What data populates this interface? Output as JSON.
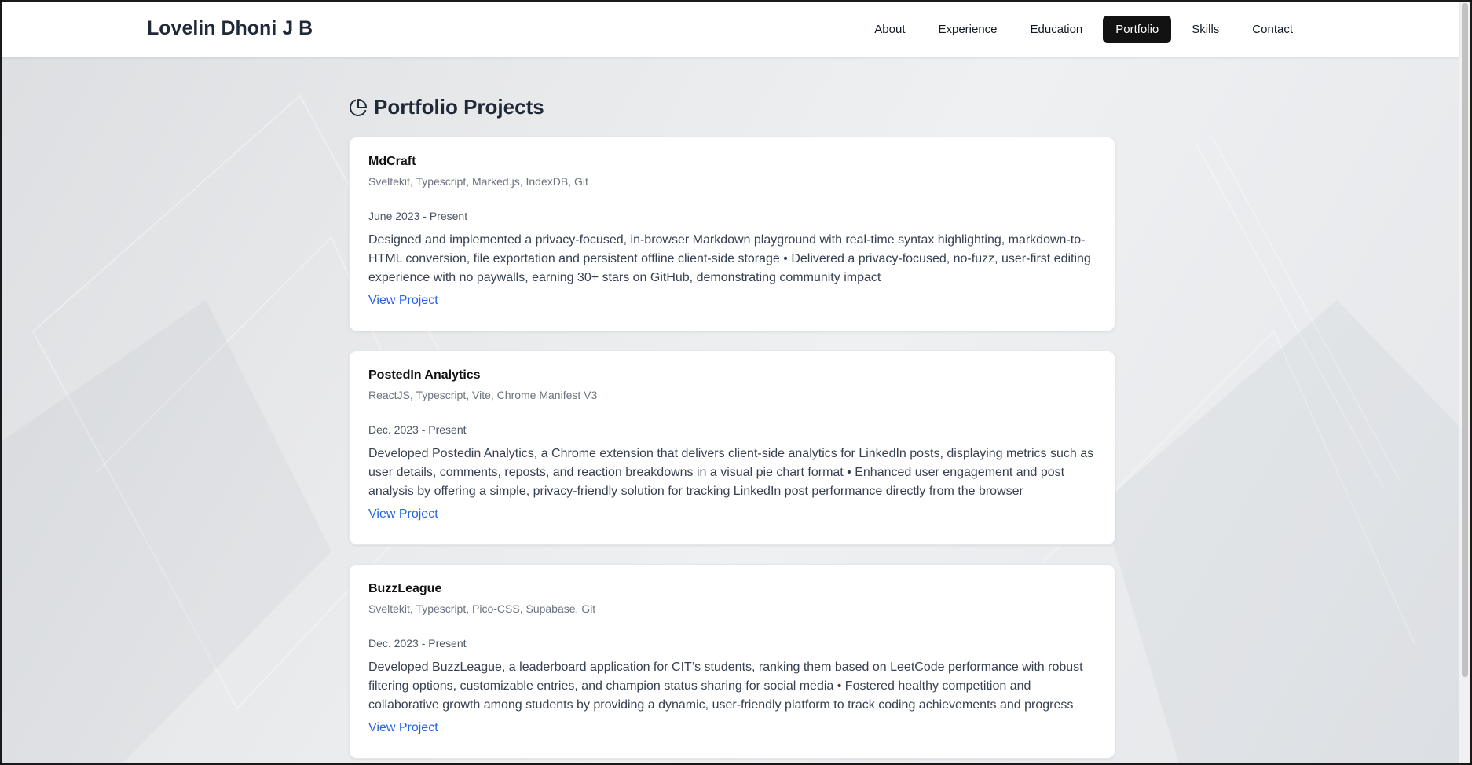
{
  "brand": "Lovelin Dhoni J B",
  "nav": [
    {
      "label": "About",
      "active": false
    },
    {
      "label": "Experience",
      "active": false
    },
    {
      "label": "Education",
      "active": false
    },
    {
      "label": "Portfolio",
      "active": true
    },
    {
      "label": "Skills",
      "active": false
    },
    {
      "label": "Contact",
      "active": false
    }
  ],
  "section": {
    "title": "Portfolio Projects",
    "icon": "pie-chart-icon"
  },
  "projects": [
    {
      "title": "MdCraft",
      "tech": "Sveltekit, Typescript, Marked.js, IndexDB, Git",
      "date": "June 2023 - Present",
      "description": "Designed and implemented a privacy-focused, in-browser Markdown playground with real-time syntax highlighting, markdown-to-HTML conversion, file exportation and persistent offline client-side storage • Delivered a privacy-focused, no-fuzz, user-first editing experience with no paywalls, earning 30+ stars on GitHub, demonstrating community impact",
      "link": "View Project"
    },
    {
      "title": "PostedIn Analytics",
      "tech": "ReactJS, Typescript, Vite, Chrome Manifest V3",
      "date": "Dec. 2023 - Present",
      "description": "Developed Postedin Analytics, a Chrome extension that delivers client-side analytics for LinkedIn posts, displaying metrics such as user details, comments, reposts, and reaction breakdowns in a visual pie chart format • Enhanced user engagement and post analysis by offering a simple, privacy-friendly solution for tracking LinkedIn post performance directly from the browser",
      "link": "View Project"
    },
    {
      "title": "BuzzLeague",
      "tech": "Sveltekit, Typescript, Pico-CSS, Supabase, Git",
      "date": "Dec. 2023 - Present",
      "description": "Developed BuzzLeague, a leaderboard application for CIT’s students, ranking them based on LeetCode performance with robust filtering options, customizable entries, and champion status sharing for social media • Fostered healthy competition and collaborative growth among students by providing a dynamic, user-friendly platform to track coding achievements and progress",
      "link": "View Project"
    }
  ],
  "colors": {
    "accent_link": "#2563eb",
    "nav_active_bg": "#121212",
    "card_bg": "#ffffff"
  }
}
